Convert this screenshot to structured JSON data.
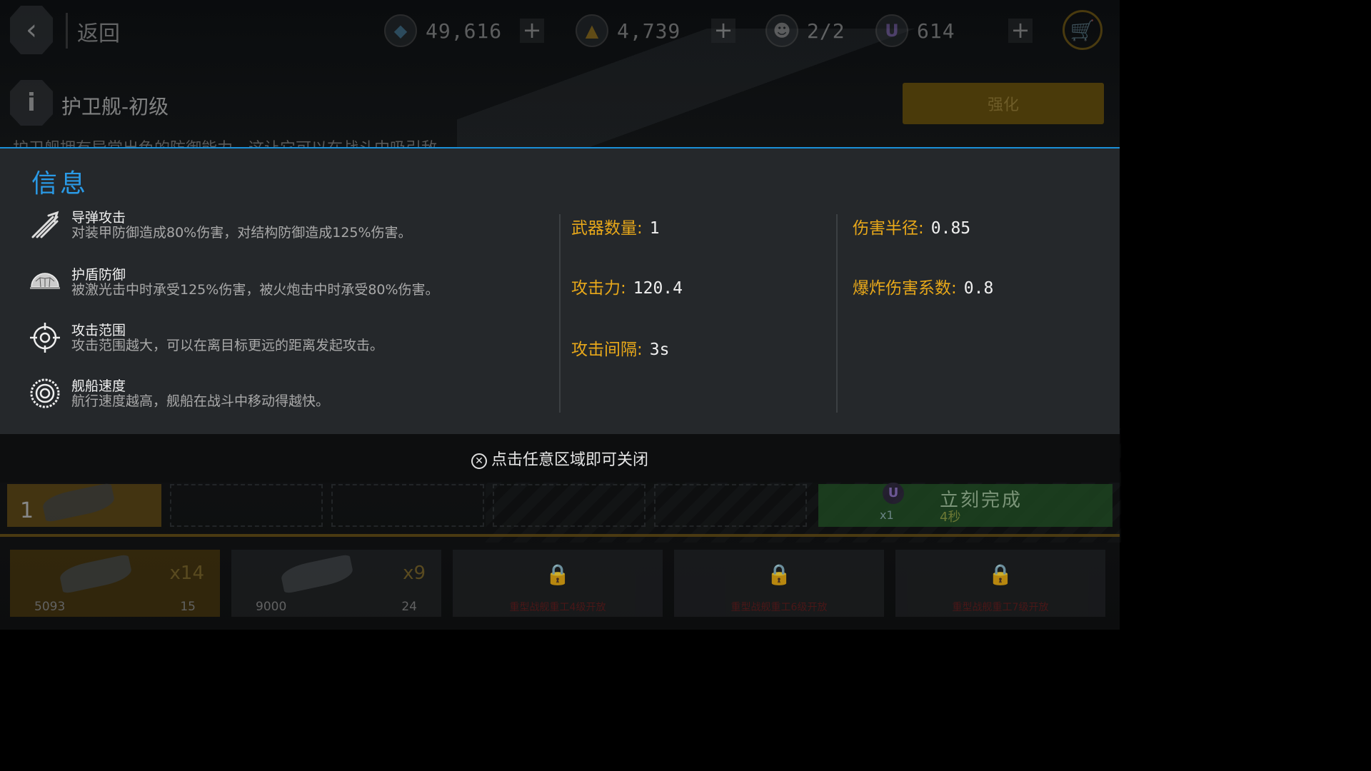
{
  "topbar": {
    "back_label": "返回",
    "resources": [
      {
        "icon": "crystal-icon",
        "value": "49,616"
      },
      {
        "icon": "gold-icon",
        "value": "4,739"
      },
      {
        "icon": "crew-icon",
        "value": "2/2"
      },
      {
        "icon": "u-currency-icon",
        "value": "614"
      }
    ]
  },
  "ship": {
    "name": "护卫舰-初级",
    "upgrade_label": "强化",
    "description_peek": "护卫舰拥有异常出色的防御能力，这让它可以在战斗中吸引敌"
  },
  "info_panel": {
    "title": "信息",
    "features": [
      {
        "icon": "missile-icon",
        "name": "导弹攻击",
        "desc": "对装甲防御造成80%伤害，对结构防御造成125%伤害。"
      },
      {
        "icon": "shield-icon",
        "name": "护盾防御",
        "desc": "被激光击中时承受125%伤害，被火炮击中时承受80%伤害。"
      },
      {
        "icon": "crosshair-icon",
        "name": "攻击范围",
        "desc": "攻击范围越大，可以在离目标更远的距离发起攻击。"
      },
      {
        "icon": "speed-icon",
        "name": "舰船速度",
        "desc": "航行速度越高，舰船在战斗中移动得越快。"
      }
    ],
    "stats_col1": [
      {
        "label": "武器数量:",
        "value": "1"
      },
      {
        "label": "攻击力:",
        "value": "120.4"
      },
      {
        "label": "攻击间隔:",
        "value": "3s"
      }
    ],
    "stats_col2": [
      {
        "label": "伤害半径:",
        "value": "0.85"
      },
      {
        "label": "爆炸伤害系数:",
        "value": "0.8"
      }
    ],
    "close_hint": "点击任意区域即可关闭"
  },
  "build_queue": {
    "first_count": "1",
    "instant_label": "立刻完成",
    "instant_time": "4秒",
    "instant_cost": "x1"
  },
  "ship_cards": [
    {
      "multiplier": "x14",
      "cost": "5093",
      "time": "15"
    },
    {
      "multiplier": "x9",
      "cost": "9000",
      "time": "24"
    },
    {
      "unlock": "重型战舰重工4级开放"
    },
    {
      "unlock": "重型战舰重工6级开放"
    },
    {
      "unlock": "重型战舰重工7级开放"
    }
  ],
  "colors": {
    "accent_blue": "#2a9ae6",
    "stat_label": "#e8a81a",
    "panel_bg": "#25282b"
  }
}
